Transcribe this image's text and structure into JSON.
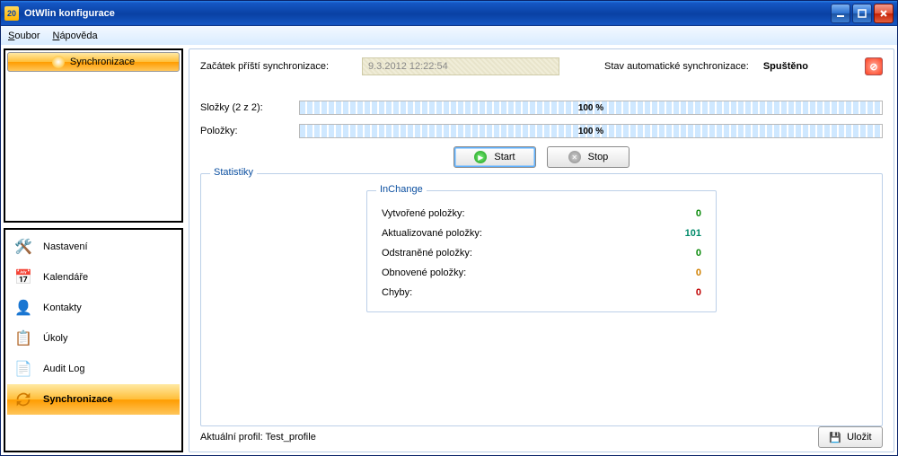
{
  "window": {
    "title": "OtWlin konfigurace"
  },
  "menu": {
    "file": "Soubor",
    "help": "Nápověda"
  },
  "sidebar": {
    "top_tab": "Synchronizace",
    "items": [
      {
        "label": "Nastavení"
      },
      {
        "label": "Kalendáře"
      },
      {
        "label": "Kontakty"
      },
      {
        "label": "Úkoly"
      },
      {
        "label": "Audit Log"
      },
      {
        "label": "Synchronizace"
      }
    ]
  },
  "main": {
    "next_sync_label": "Začátek příští synchronizace:",
    "next_sync_value": "9.3.2012 12:22:54",
    "auto_state_label": "Stav automatické synchronizace:",
    "auto_state_value": "Spuštěno",
    "folders_label": "Složky (2 z 2):",
    "folders_pct": "100 %",
    "items_label": "Položky:",
    "items_pct": "100 %",
    "start_label": "Start",
    "stop_label": "Stop"
  },
  "stats": {
    "legend": "Statistiky",
    "inner_legend": "InChange",
    "created_label": "Vytvořené položky:",
    "created_value": "0",
    "updated_label": "Aktualizované položky:",
    "updated_value": "101",
    "removed_label": "Odstraněné položky:",
    "removed_value": "0",
    "restored_label": "Obnovené položky:",
    "restored_value": "0",
    "errors_label": "Chyby:",
    "errors_value": "0"
  },
  "footer": {
    "profile_label": "Aktuální profil: Test_profile",
    "save_label": "Uložit"
  }
}
